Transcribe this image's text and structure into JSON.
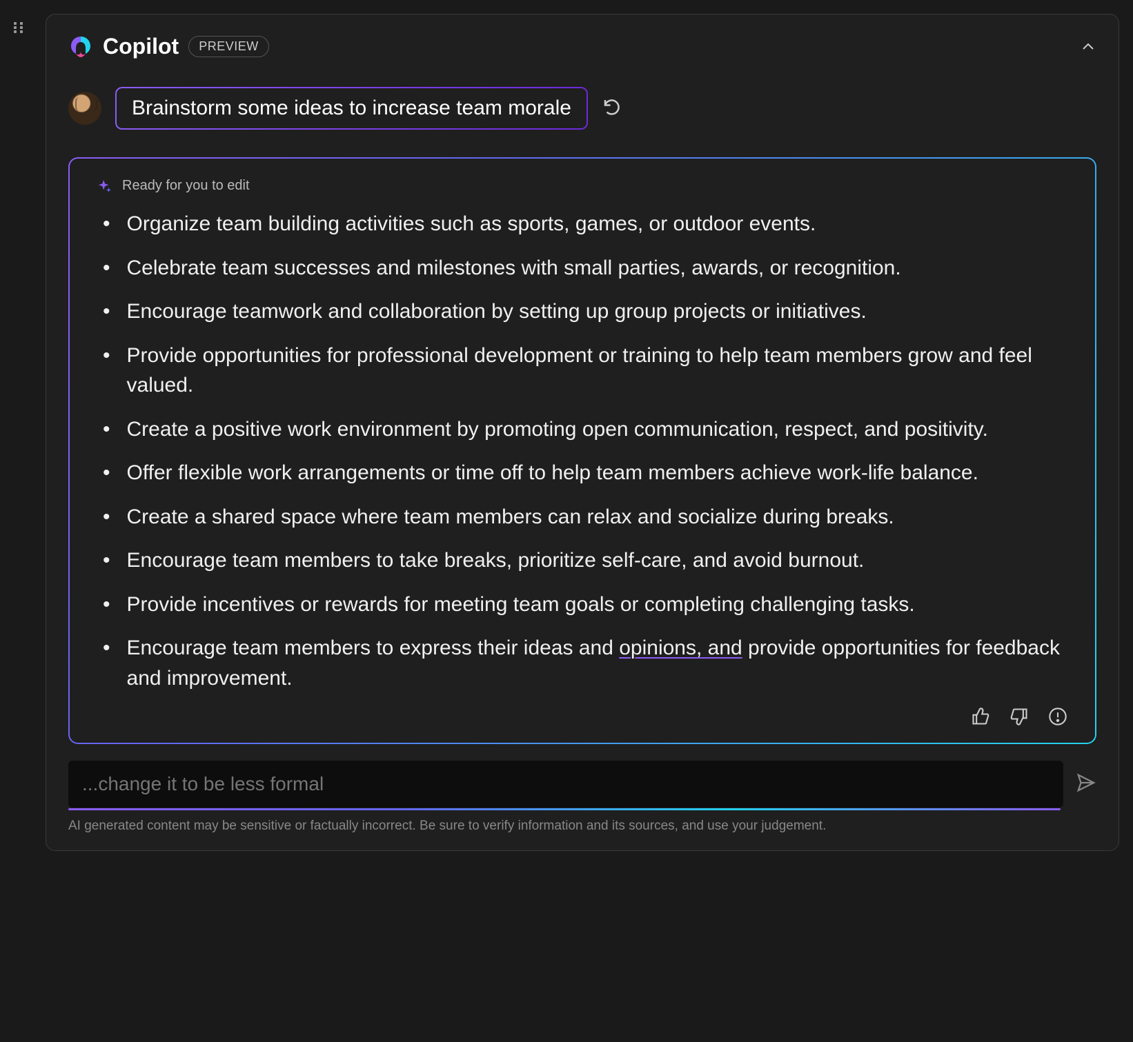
{
  "header": {
    "title": "Copilot",
    "badge": "PREVIEW"
  },
  "prompt": {
    "text": "Brainstorm some ideas to increase team morale"
  },
  "response": {
    "ready_label": "Ready for you to edit",
    "items": [
      "Organize team building activities such as sports, games, or outdoor events.",
      "Celebrate team successes and milestones with small parties, awards, or recognition.",
      "Encourage teamwork and collaboration by setting up group projects or initiatives.",
      "Provide opportunities for professional development or training to help team members grow and feel valued.",
      "Create a positive work environment by promoting open communication, respect, and positivity.",
      "Offer flexible work arrangements or time off to help team members achieve work-life balance.",
      "Create a shared space where team members can relax and socialize during breaks.",
      "Encourage team members to take breaks, prioritize self-care, and avoid burnout.",
      "Provide incentives or rewards for meeting team goals or completing challenging tasks."
    ],
    "last_item_pre": "Encourage team members to express their ideas and ",
    "last_item_underlined": "opinions, and",
    "last_item_post": " provide opportunities for feedback and improvement."
  },
  "input": {
    "placeholder": "...change it to be less formal",
    "value": ""
  },
  "disclaimer": "AI generated content may be sensitive or factually incorrect. Be sure to verify information and its sources, and use your judgement."
}
